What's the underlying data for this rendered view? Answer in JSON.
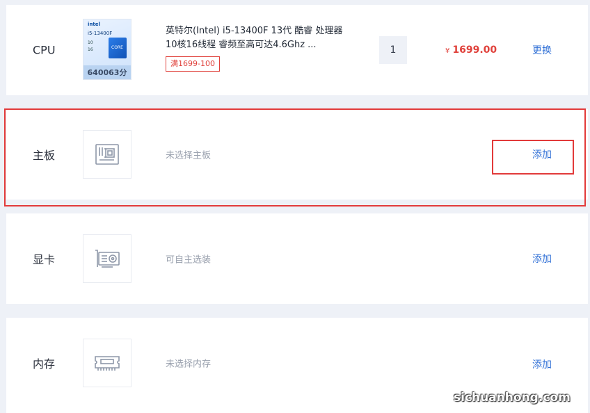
{
  "rows": {
    "cpu": {
      "category": "CPU",
      "product_title": "英特尔(Intel) i5-13400F 13代 酷睿 处理器 10核16线程 睿频至高可达4.6Ghz ...",
      "image_brand": "intel",
      "image_model": "i5-13400F",
      "image_chip": "CORE",
      "score": "640063分",
      "promo": "满1699-100",
      "quantity": "1",
      "price_symbol": "¥",
      "price": "1699.00",
      "action": "更换"
    },
    "motherboard": {
      "category": "主板",
      "placeholder": "未选择主板",
      "action": "添加"
    },
    "gpu": {
      "category": "显卡",
      "placeholder": "可自主选装",
      "action": "添加"
    },
    "ram": {
      "category": "内存",
      "placeholder": "未选择内存",
      "action": "添加"
    }
  },
  "watermark": "sichuanhong.com",
  "colors": {
    "accent": "#2f6fd6",
    "price": "#e0413b",
    "highlight": "#e23a3a",
    "background": "#eef1f7"
  },
  "icons": {
    "motherboard": "motherboard-icon",
    "gpu": "graphics-card-icon",
    "ram": "memory-module-icon"
  }
}
